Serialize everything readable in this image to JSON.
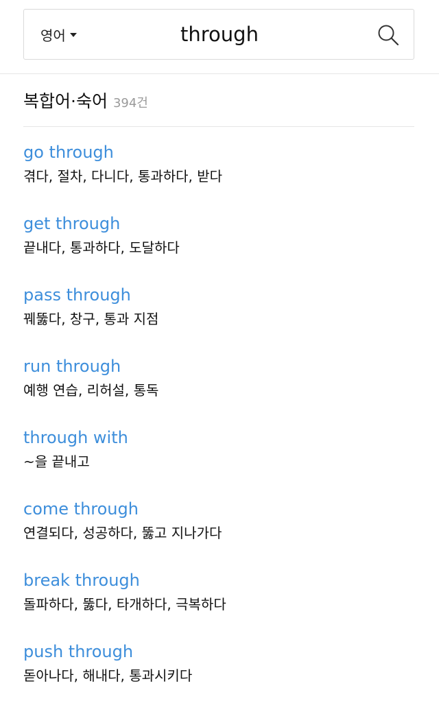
{
  "search": {
    "language": "영어",
    "query": "through"
  },
  "section": {
    "title": "복합어·숙어",
    "count": "394건"
  },
  "entries": [
    {
      "phrase": "go through",
      "meaning": "겪다, 절차, 다니다, 통과하다, 받다"
    },
    {
      "phrase": "get through",
      "meaning": "끝내다, 통과하다, 도달하다"
    },
    {
      "phrase": "pass through",
      "meaning": "꿰뚫다, 창구, 통과 지점"
    },
    {
      "phrase": "run through",
      "meaning": "예행 연습, 리허설, 통독"
    },
    {
      "phrase": "through with",
      "meaning": "~을 끝내고"
    },
    {
      "phrase": "come through",
      "meaning": "연결되다, 성공하다, 뚫고 지나가다"
    },
    {
      "phrase": "break through",
      "meaning": "돌파하다, 뚫다, 타개하다, 극복하다"
    },
    {
      "phrase": "push through",
      "meaning": "돋아나다, 해내다, 통과시키다"
    }
  ],
  "icons": {
    "search": "search-icon",
    "dropdown": "chevron-down-icon"
  },
  "colors": {
    "link": "#3d8edb",
    "count": "#9a9a9a"
  }
}
